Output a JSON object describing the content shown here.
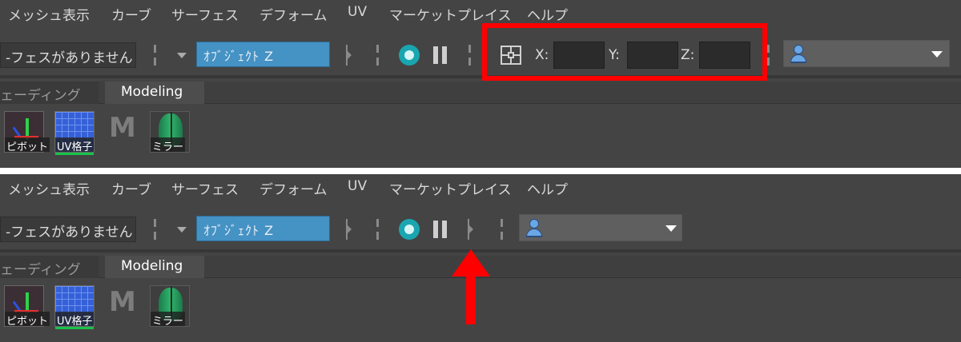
{
  "menu": [
    "メッシュ表示",
    "カーブ",
    "サーフェス",
    "デフォーム",
    "UV",
    "マーケットプレイス",
    "ヘルプ"
  ],
  "selection_mask_label": "-フェスがありません",
  "object_field_value": "ｵﾌﾞｼﾞｪｸﾄ Z",
  "coords": {
    "x_label": "X:",
    "y_label": "Y:",
    "z_label": "Z:",
    "x_value": "",
    "y_value": "",
    "z_value": ""
  },
  "shelf_tabs": {
    "inactive": "ェーディング",
    "active": "Modeling"
  },
  "tools": {
    "pivot": "ピボット",
    "uv": "UV格子",
    "m_logo": "M",
    "mirror": "ミラー"
  },
  "colors": {
    "accent_field": "#4592c4",
    "highlight": "#ff0000",
    "record": "#1aa6b0"
  },
  "icons": [
    "chevron-down-icon",
    "record-icon",
    "pause-icon",
    "snap-grid-icon",
    "user-icon",
    "dropdown-arrow-icon",
    "pivot-tool-icon",
    "uv-grid-icon",
    "m-logo-icon",
    "mirror-face-icon"
  ]
}
